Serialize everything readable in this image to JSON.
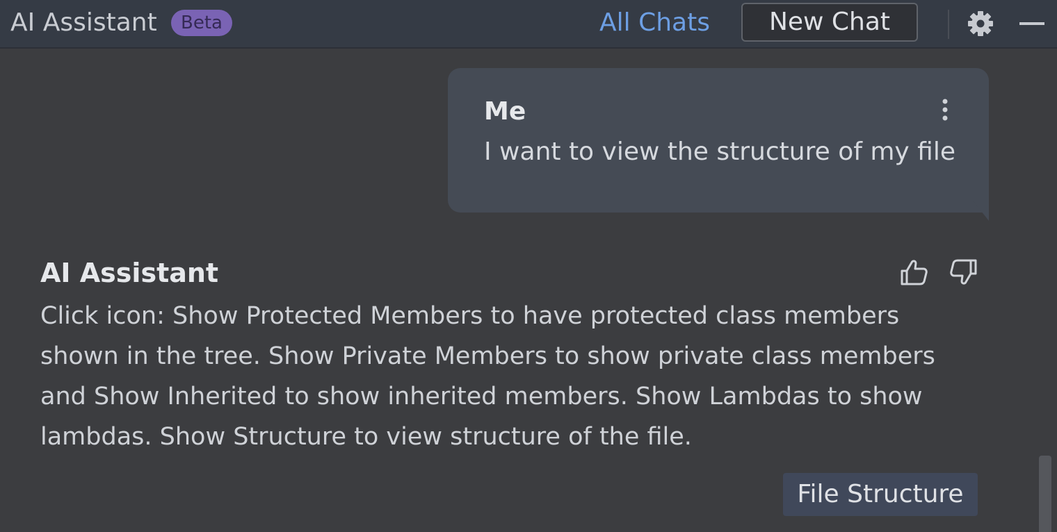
{
  "header": {
    "title": "AI Assistant",
    "badge": "Beta",
    "all_chats": "All Chats",
    "new_chat": "New Chat"
  },
  "icons": {
    "settings": "gear-icon",
    "minimize": "minimize-icon",
    "more": "more-vertical-icon",
    "like": "thumbs-up-icon",
    "dislike": "thumbs-down-icon"
  },
  "messages": {
    "user": {
      "author": "Me",
      "text": "I want to view the structure of my file"
    },
    "assistant": {
      "author": "AI Assistant",
      "lines": [
        "Click icon: Show Protected Members to have protected class members",
        "shown in the tree. Show Private Members to show private class members",
        "and Show Inherited to show inherited members. Show Lambdas to show",
        "lambdas. Show Structure to view structure of the file."
      ],
      "action_label": "File Structure"
    }
  },
  "colors": {
    "background": "#3c3d40",
    "header_bg": "#353b45",
    "accent_link": "#6d9fe4",
    "beta_badge": "#7a63b4",
    "user_bubble": "#454b55"
  }
}
